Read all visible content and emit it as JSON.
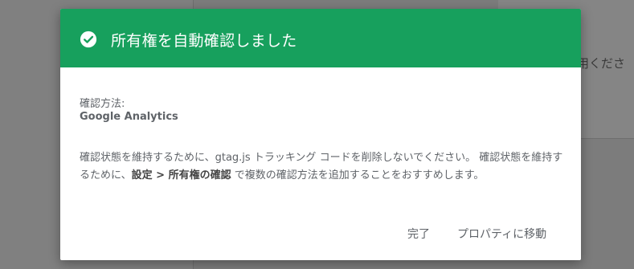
{
  "background": {
    "partial_text": "用くださ"
  },
  "dialog": {
    "header_color": "#17a05d",
    "icon": "check-circle-icon",
    "title": "所有権を自動確認しました",
    "method_label": "確認方法:",
    "method_value": "Google Analytics",
    "description_part1": "確認状態を維持するために、gtag.js トラッキング コードを削除しないでください。 確認状態を維持するために、",
    "description_bold": "設定 > 所有権の確認",
    "description_part2": " で複数の確認方法を追加することをおすすめします。",
    "buttons": {
      "done": "完了",
      "go_to_property": "プロパティに移動"
    }
  }
}
